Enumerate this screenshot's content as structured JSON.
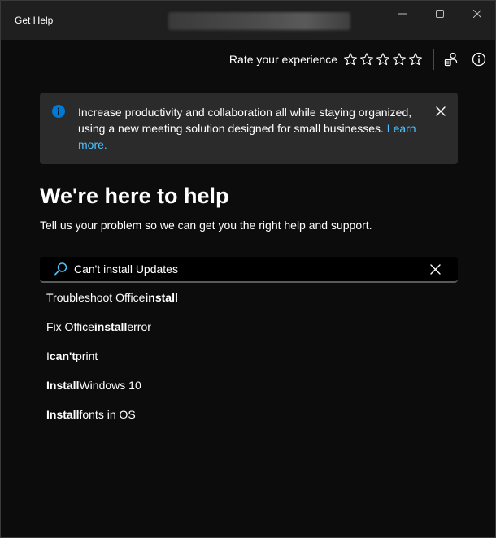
{
  "window": {
    "title": "Get Help"
  },
  "rating": {
    "label": "Rate your experience",
    "stars_total": 5
  },
  "banner": {
    "text": "Increase productivity and collaboration all while staying organized, using a new meeting solution designed for small businesses.",
    "link_text": "Learn more."
  },
  "main": {
    "title": "We're here to help",
    "subtitle": "Tell us your problem so we can get you the right help and support."
  },
  "search": {
    "value": "Can't install Updates",
    "placeholder": ""
  },
  "suggestions": [
    {
      "before": "Troubleshoot Office ",
      "bold": "install",
      "after": ""
    },
    {
      "before": "Fix Office ",
      "bold": "install",
      "after": " error"
    },
    {
      "before": "I ",
      "bold": "can't",
      "after": " print"
    },
    {
      "before": "",
      "bold": "Install",
      "after": " Windows 10"
    },
    {
      "before": "",
      "bold": "Install",
      "after": " fonts in OS"
    }
  ],
  "icons": {
    "minimize": "minimize-icon",
    "maximize": "maximize-icon",
    "close": "close-icon",
    "star": "star-outline-icon",
    "contact": "contact-support-icon",
    "about": "info-circle-icon",
    "banner_info": "info-filled-icon",
    "banner_close": "close-icon",
    "search": "search-icon",
    "clear": "clear-icon"
  },
  "colors": {
    "background": "#0c0c0c",
    "titlebar": "#1f1f1f",
    "banner": "#2b2b2b",
    "accent": "#4cc2ff",
    "info_icon": "#0078d4"
  }
}
